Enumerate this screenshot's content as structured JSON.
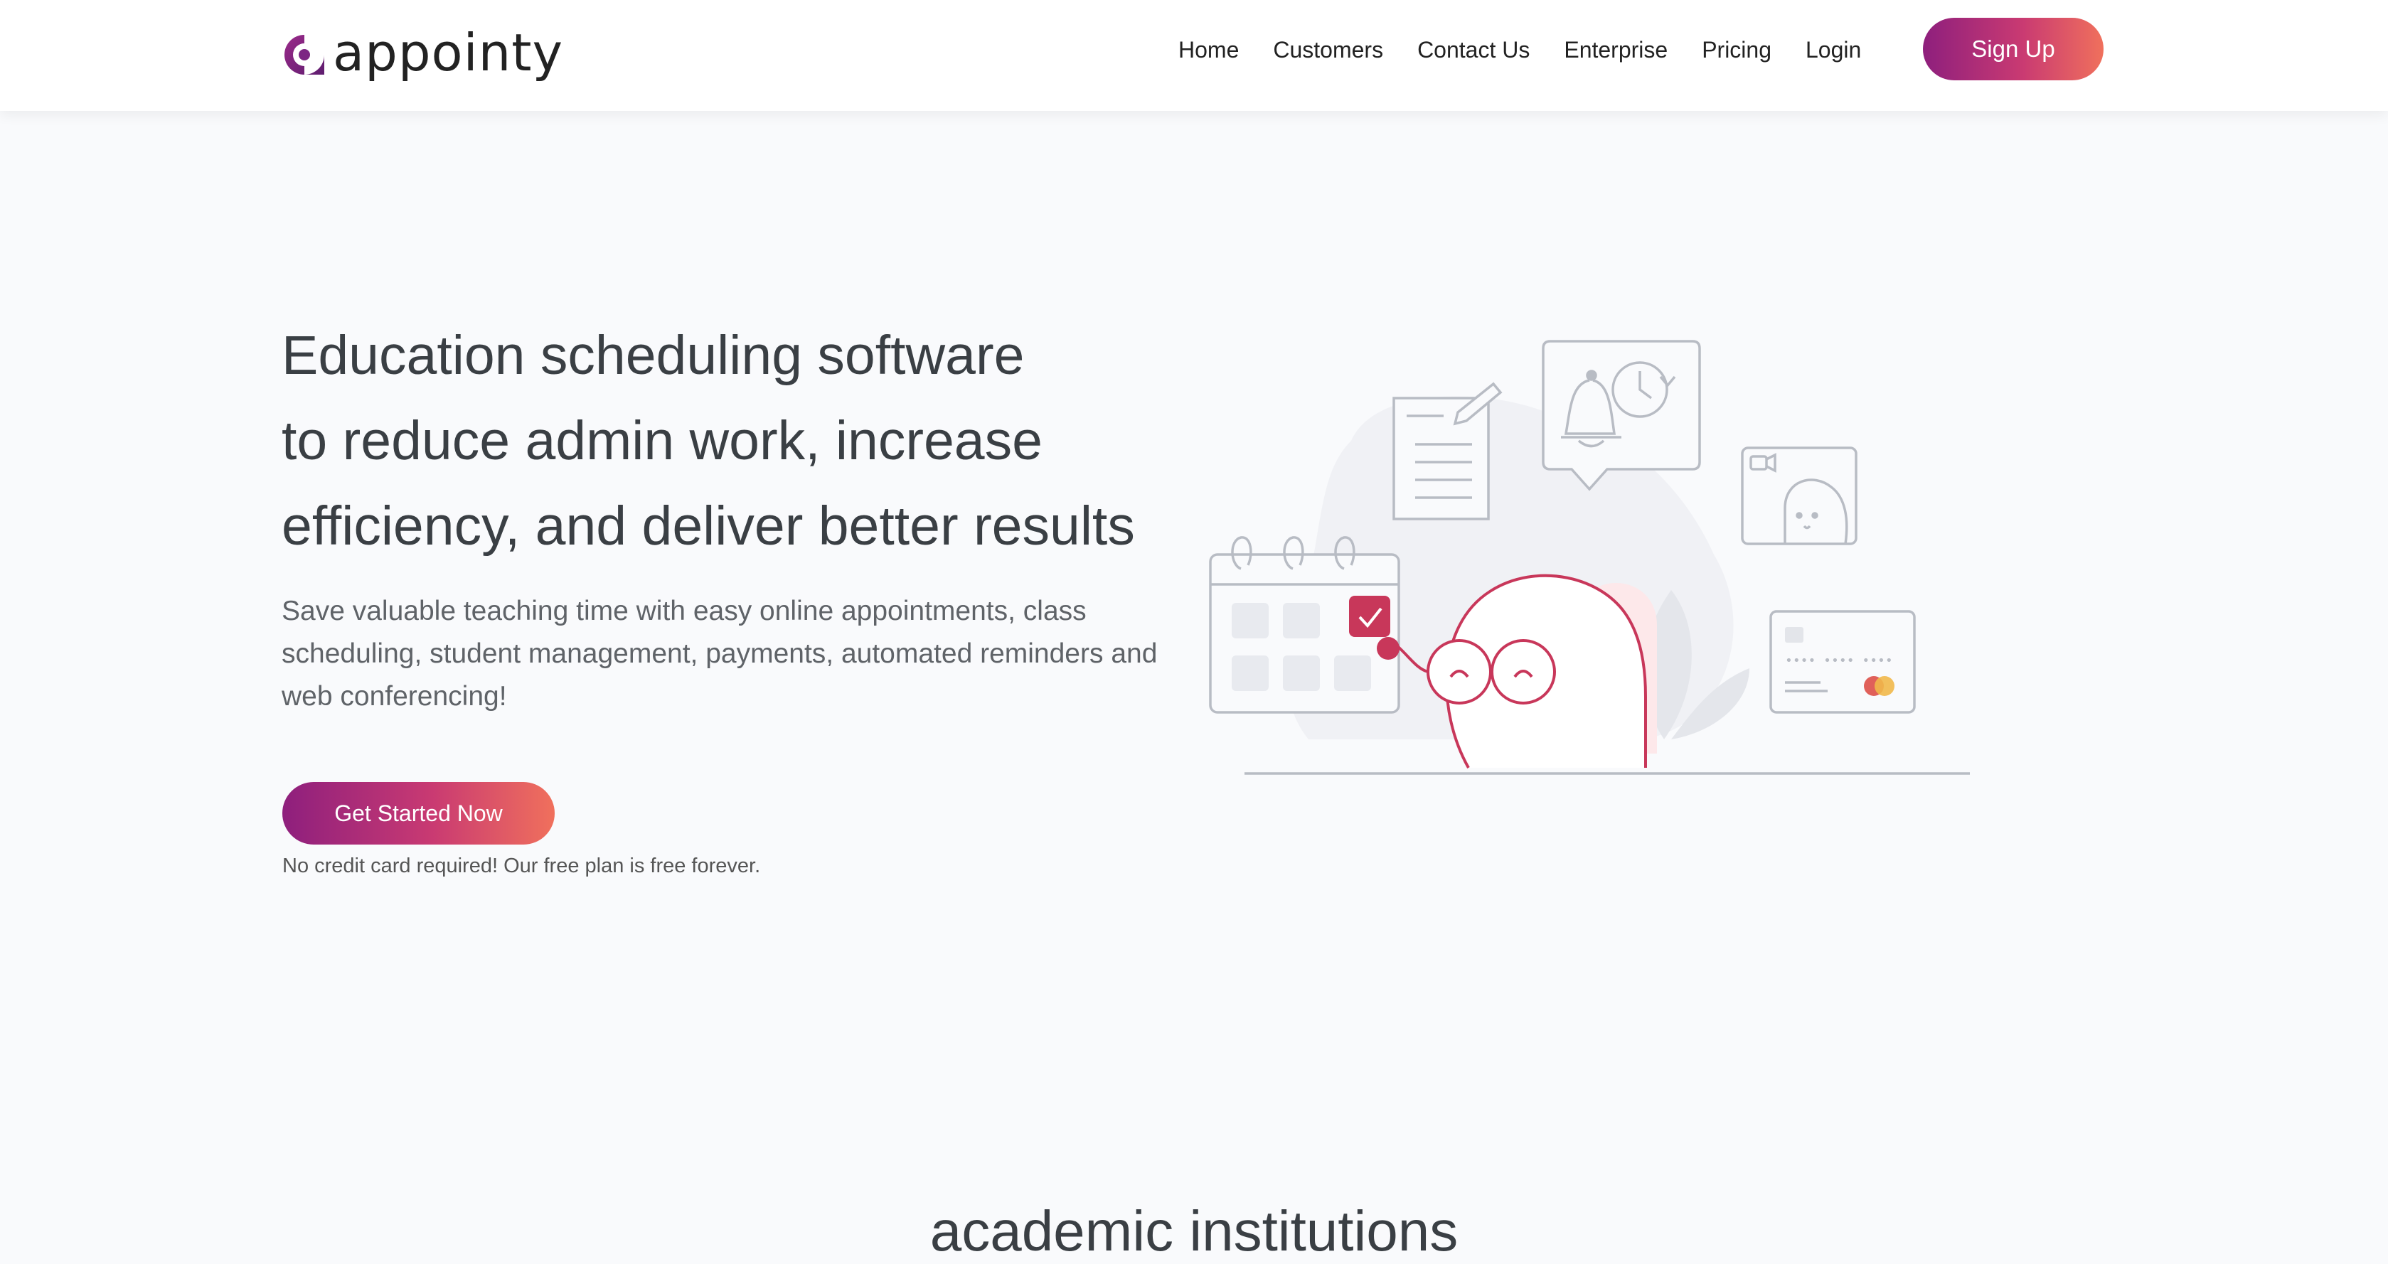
{
  "header": {
    "logo_text": "appointy",
    "nav": [
      "Home",
      "Customers",
      "Contact Us",
      "Enterprise",
      "Pricing",
      "Login"
    ],
    "signup_label": "Sign Up"
  },
  "hero": {
    "headline_lines": [
      "Education scheduling software",
      "to reduce admin work, increase",
      "efficiency, and deliver better results"
    ],
    "subtext": "Save valuable teaching time with easy online appointments, class scheduling, student management, payments, automated reminders and web conferencing!",
    "cta_label": "Get Started Now",
    "cta_note": "No credit card required! Our free plan is free forever."
  },
  "section": {
    "title": "academic institutions"
  },
  "colors": {
    "brand_gradient_start": "#8e1f7d",
    "brand_gradient_end": "#f0705c",
    "illustration_accent": "#c8375a"
  }
}
